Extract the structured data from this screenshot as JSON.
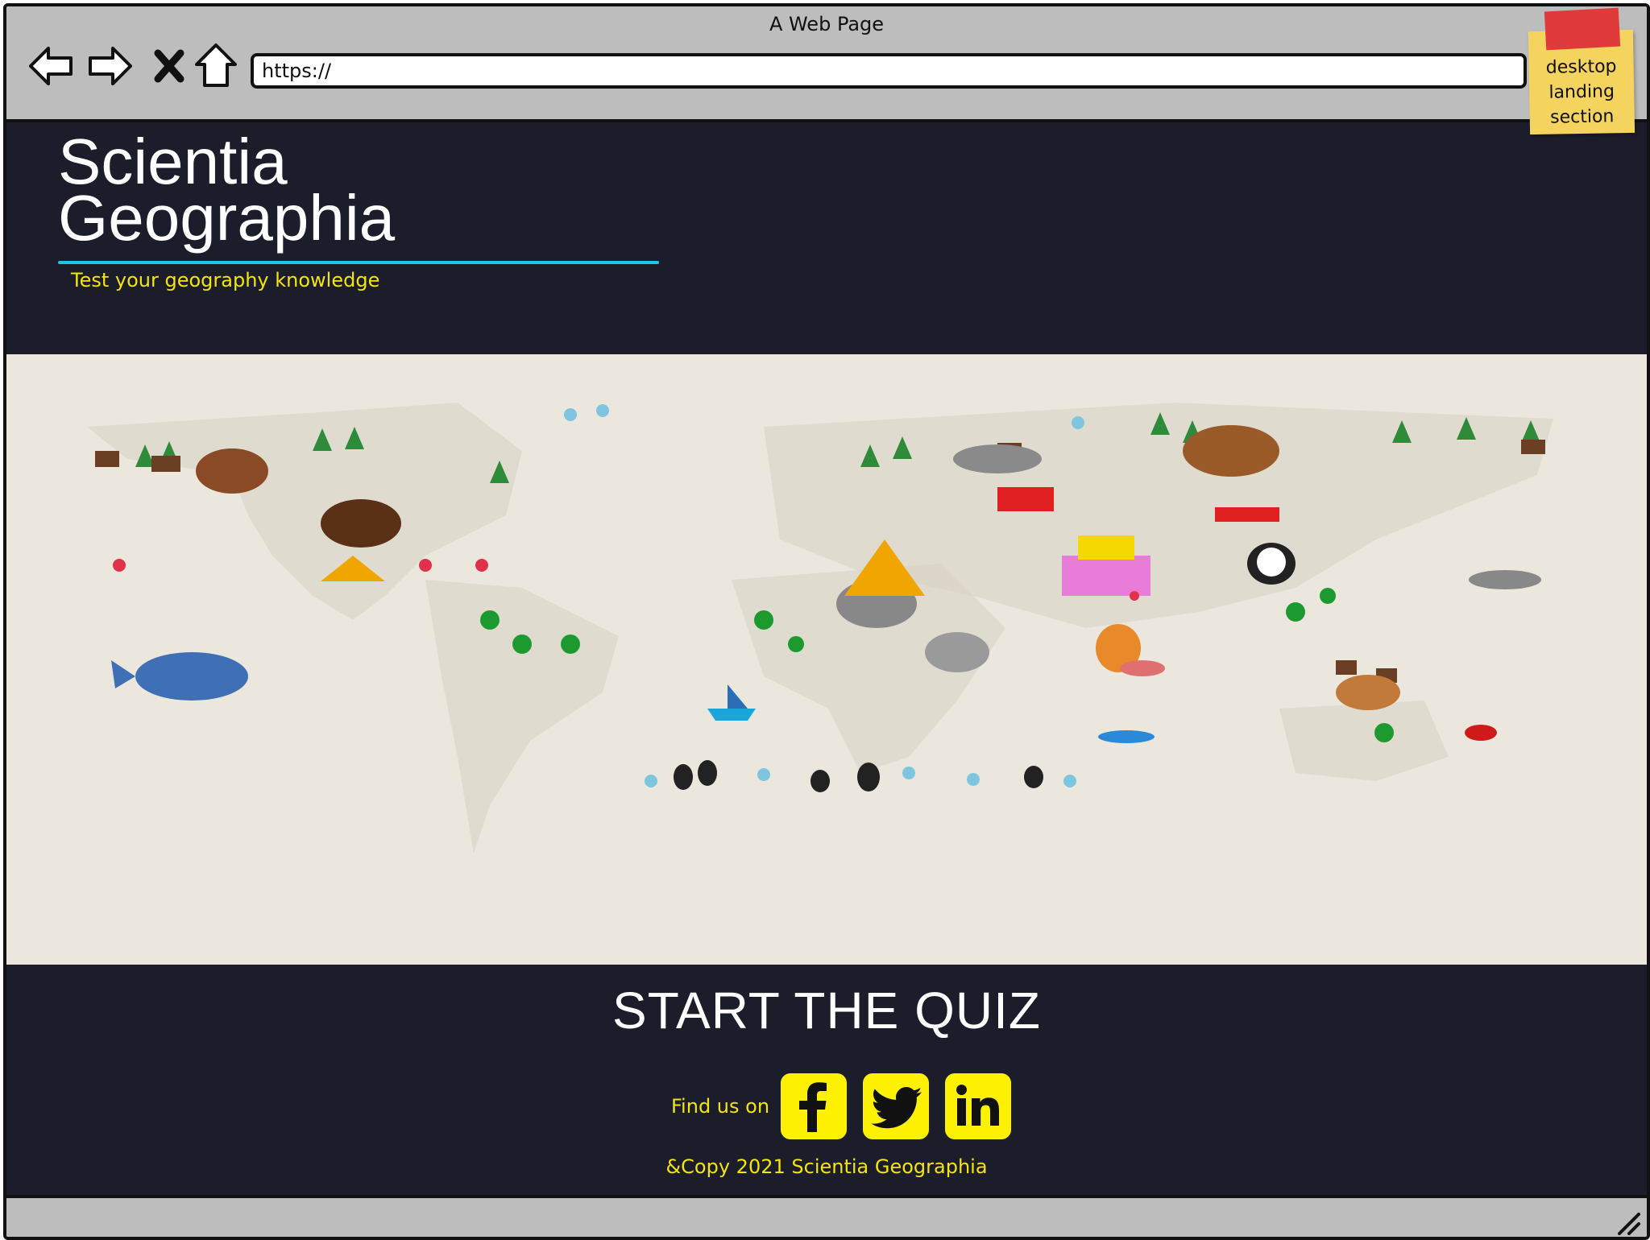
{
  "window": {
    "title": "A Web Page"
  },
  "toolbar": {
    "url": "https://",
    "back_icon": "arrow-left-icon",
    "forward_icon": "arrow-right-icon",
    "stop_icon": "close-icon",
    "home_icon": "home-icon"
  },
  "annotation": {
    "note": "desktop landing section"
  },
  "header": {
    "brand_line1": "Scientia",
    "brand_line2": "Geographia",
    "tagline": "Test your geography knowledge"
  },
  "main": {
    "cta": "START THE QUIZ"
  },
  "footer": {
    "find_label": "Find us on",
    "social": [
      {
        "name": "facebook-icon"
      },
      {
        "name": "twitter-icon"
      },
      {
        "name": "linkedin-icon"
      }
    ],
    "copyright": "&Copy 2021 Scientia Geographia"
  },
  "colors": {
    "page_bg": "#1b1d2a",
    "accent_yellow": "#f5e50a",
    "underline_cyan": "#1fc8e3",
    "icon_bg": "#fff200",
    "map_bg": "#ece7dd",
    "sticky": "#f4d35e"
  }
}
